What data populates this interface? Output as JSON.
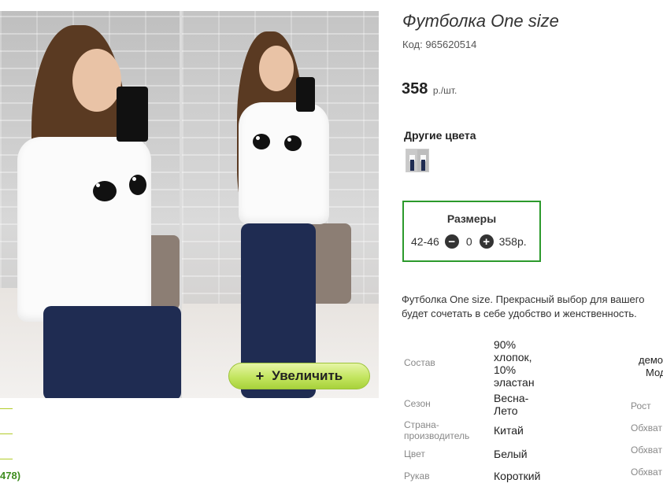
{
  "product": {
    "title": "Футболка One size",
    "code": "Код: 965620514",
    "price": "358",
    "price_unit": "р./шт."
  },
  "gallery": {
    "zoom_button": "Увеличить",
    "zoom_plus": "+"
  },
  "left_strip": {
    "count": "478)"
  },
  "other_colors": {
    "title": "Другие цвета"
  },
  "sizes": {
    "title": "Размеры",
    "rows": [
      {
        "size": "42-46",
        "qty": "0",
        "price": "358р."
      }
    ]
  },
  "description": {
    "line1": "Футболка One size. Прекрасный выбор для вашего",
    "line2": "будет сочетать в себе удобство и женственность."
  },
  "specs": [
    {
      "label": "Состав",
      "value": "90% хлопок, 10% эластан"
    },
    {
      "label": "Сезон",
      "value": "Весна-Лето"
    },
    {
      "label": "Страна-производитель",
      "value": "Китай"
    },
    {
      "label": "Цвет",
      "value": "Белый"
    },
    {
      "label": "Рукав",
      "value": "Короткий"
    }
  ],
  "extra_specs": {
    "demo1": "демо",
    "demo2": "Мод",
    "height": "Рост",
    "girth1": "Обхват",
    "girth2": "Обхват",
    "girth3": "Обхват"
  }
}
